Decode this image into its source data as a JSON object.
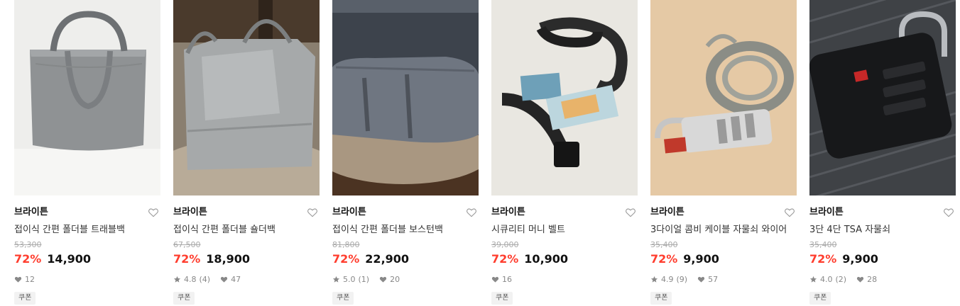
{
  "products": [
    {
      "brand": "브라이튼",
      "title": "접이식 간편 폴더블 트래블백",
      "original_price": "53,300",
      "discount": "72%",
      "price": "14,900",
      "rating": "",
      "review_count": "",
      "likes": "12",
      "badge": "쿠폰",
      "image_icon": "gray-tote-bag-photo"
    },
    {
      "brand": "브라이튼",
      "title": "접이식 간편 폴더블 숄더백",
      "original_price": "67,500",
      "discount": "72%",
      "price": "18,900",
      "rating": "4.8",
      "review_count": "(4)",
      "likes": "47",
      "badge": "쿠폰",
      "image_icon": "gray-shoulder-bag-photo"
    },
    {
      "brand": "브라이튼",
      "title": "접이식 간편 폴더블 보스턴백",
      "original_price": "81,800",
      "discount": "72%",
      "price": "22,900",
      "rating": "5.0",
      "review_count": "(1)",
      "likes": "20",
      "badge": "쿠폰",
      "image_icon": "gray-boston-bag-photo"
    },
    {
      "brand": "브라이튼",
      "title": "시큐리티 머니 벨트",
      "original_price": "39,000",
      "discount": "72%",
      "price": "10,900",
      "rating": "",
      "review_count": "",
      "likes": "16",
      "badge": "쿠폰",
      "image_icon": "money-belt-photo"
    },
    {
      "brand": "브라이튼",
      "title": "3다이얼 콤비 케이블 자물쇠 와이어",
      "original_price": "35,400",
      "discount": "72%",
      "price": "9,900",
      "rating": "4.9",
      "review_count": "(9)",
      "likes": "57",
      "badge": "쿠폰",
      "image_icon": "cable-combo-lock-photo"
    },
    {
      "brand": "브라이튼",
      "title": "3단 4단 TSA 자물쇠",
      "original_price": "35,400",
      "discount": "72%",
      "price": "9,900",
      "rating": "4.0",
      "review_count": "(2)",
      "likes": "28",
      "badge": "쿠폰",
      "image_icon": "tsa-lock-photo"
    }
  ],
  "colors": {
    "discount": "#ff3d2e",
    "original_price": "#aaaaaa",
    "badge_bg": "#f2f2f2"
  },
  "icons": {
    "wishlist": "heart-outline-icon",
    "likes": "heart-filled-icon",
    "rating": "star-icon"
  }
}
